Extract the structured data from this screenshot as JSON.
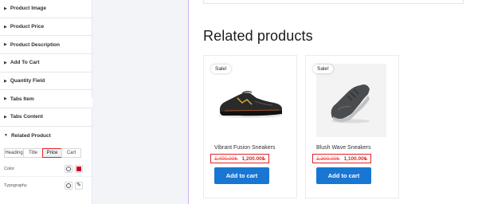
{
  "panel": {
    "sections": [
      {
        "label": "Product Image"
      },
      {
        "label": "Product Price"
      },
      {
        "label": "Product Description"
      },
      {
        "label": "Add To Cart"
      },
      {
        "label": "Quantity Field"
      },
      {
        "label": "Tabs Item"
      },
      {
        "label": "Tabs Content"
      },
      {
        "label": "Related Product",
        "open": true
      }
    ],
    "tabs": [
      {
        "label": "Heading"
      },
      {
        "label": "Title"
      },
      {
        "label": "Price",
        "active": true
      },
      {
        "label": "Cart"
      }
    ],
    "controls": {
      "color_label": "Color",
      "color_value": "#d0021b",
      "typography_label": "Typography"
    },
    "collapse_glyph": "‹"
  },
  "content": {
    "heading": "Related products",
    "products": [
      {
        "badge": "Sale!",
        "name": "Vibrant Fusion Sneakers",
        "old_price": "1,400.00₺",
        "new_price": "1,200.00₺",
        "button": "Add to cart"
      },
      {
        "badge": "Sale!",
        "name": "Blush Wave Sneakers",
        "old_price": "1,300.00₺",
        "new_price": "1,100.00₺",
        "button": "Add to cart"
      }
    ]
  },
  "colors": {
    "accent_button": "#1976d2",
    "highlight_border": "#e02424",
    "sale_price": "#e02424"
  }
}
